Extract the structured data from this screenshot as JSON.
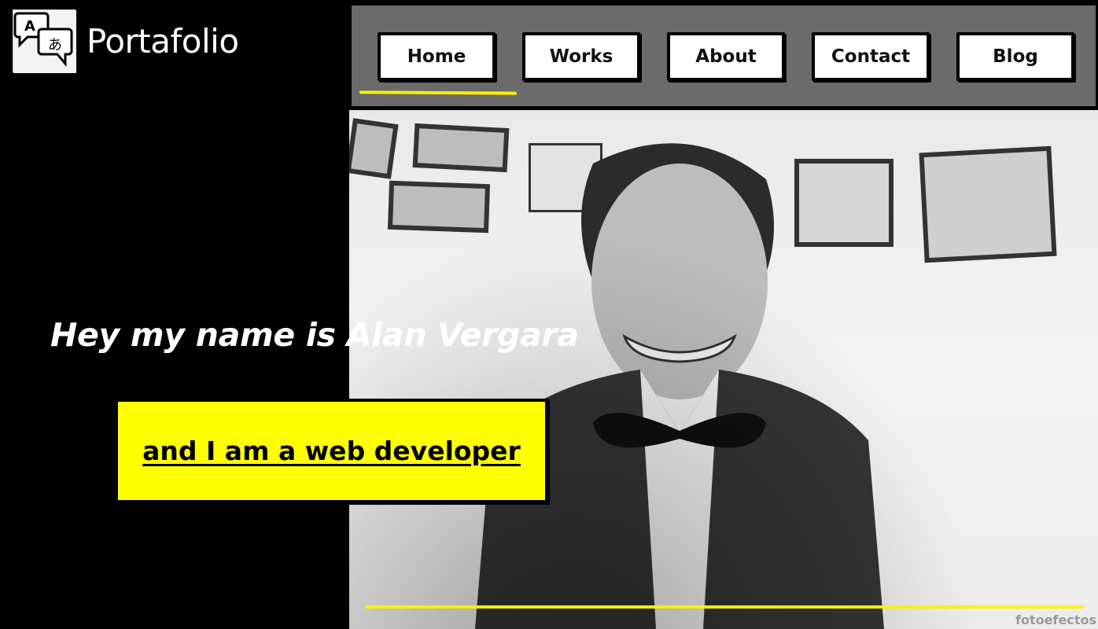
{
  "brand": {
    "name": "Portafolio",
    "icon": "translate-icon"
  },
  "nav": {
    "items": [
      {
        "label": "Home",
        "active": true
      },
      {
        "label": "Works",
        "active": false
      },
      {
        "label": "About",
        "active": false
      },
      {
        "label": "Contact",
        "active": false
      },
      {
        "label": "Blog",
        "active": false
      }
    ]
  },
  "hero": {
    "greeting": "Hey my name is Alan Vergara",
    "cta": "and I am a web developer",
    "photo": "profile-photo"
  },
  "watermark": "fotoefectos",
  "colors": {
    "accent": "#ffff00",
    "nav_bg": "#6b6b6b",
    "panel_bg": "#000000"
  }
}
